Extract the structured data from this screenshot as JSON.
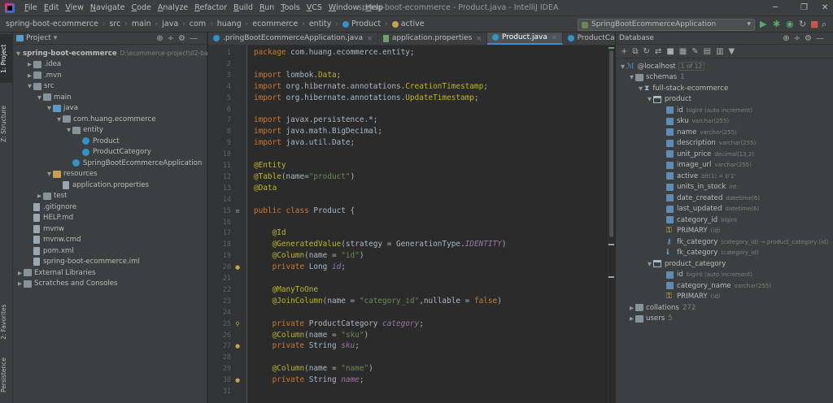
{
  "menu": [
    "File",
    "Edit",
    "View",
    "Navigate",
    "Code",
    "Analyze",
    "Refactor",
    "Build",
    "Run",
    "Tools",
    "VCS",
    "Window",
    "Help"
  ],
  "window_title": "spring-boot-ecommerce - Product.java - IntelliJ IDEA",
  "breadcrumbs": [
    "spring-boot-ecommerce",
    "src",
    "main",
    "java",
    "com",
    "huang",
    "ecommerce",
    "entity",
    "Product",
    "active"
  ],
  "run_config": "SpringBootEcommerceApplication",
  "left_tabs": [
    "1: Project",
    "Z: Structure",
    "2: Favorites",
    "Persistence"
  ],
  "project": {
    "title": "Project",
    "tree": [
      {
        "label": "spring-boot-ecommerce",
        "extra": "D:\\ecommerce-project\\02-backen",
        "depth": 0,
        "arrow": "▼",
        "icon": "folder"
      },
      {
        "label": ".idea",
        "depth": 1,
        "arrow": "▶",
        "icon": "folder"
      },
      {
        "label": ".mvn",
        "depth": 1,
        "arrow": "▶",
        "icon": "folder"
      },
      {
        "label": "src",
        "depth": 1,
        "arrow": "▼",
        "icon": "folder"
      },
      {
        "label": "main",
        "depth": 2,
        "arrow": "▼",
        "icon": "folder"
      },
      {
        "label": "java",
        "depth": 3,
        "arrow": "▼",
        "icon": "folder-blue"
      },
      {
        "label": "com.huang.ecommerce",
        "depth": 4,
        "arrow": "▼",
        "icon": "folder"
      },
      {
        "label": "entity",
        "depth": 5,
        "arrow": "▼",
        "icon": "folder"
      },
      {
        "label": "Product",
        "depth": 6,
        "arrow": "",
        "icon": "cls"
      },
      {
        "label": "ProductCategory",
        "depth": 6,
        "arrow": "",
        "icon": "cls"
      },
      {
        "label": "SpringBootEcommerceApplication",
        "depth": 5,
        "arrow": "",
        "icon": "cls"
      },
      {
        "label": "resources",
        "depth": 3,
        "arrow": "▼",
        "icon": "folder-yellow"
      },
      {
        "label": "application.properties",
        "depth": 4,
        "arrow": "",
        "icon": "file"
      },
      {
        "label": "test",
        "depth": 2,
        "arrow": "▶",
        "icon": "folder"
      },
      {
        "label": ".gitignore",
        "depth": 1,
        "arrow": "",
        "icon": "file"
      },
      {
        "label": "HELP.md",
        "depth": 1,
        "arrow": "",
        "icon": "file"
      },
      {
        "label": "mvnw",
        "depth": 1,
        "arrow": "",
        "icon": "file"
      },
      {
        "label": "mvnw.cmd",
        "depth": 1,
        "arrow": "",
        "icon": "file"
      },
      {
        "label": "pom.xml",
        "depth": 1,
        "arrow": "",
        "icon": "file"
      },
      {
        "label": "spring-boot-ecommerce.iml",
        "depth": 1,
        "arrow": "",
        "icon": "file"
      },
      {
        "label": "External Libraries",
        "depth": 0,
        "arrow": "▶",
        "icon": "folder"
      },
      {
        "label": "Scratches and Consoles",
        "depth": 0,
        "arrow": "▶",
        "icon": "folder"
      }
    ]
  },
  "tabs": [
    {
      "label": ".pringBootEcommerceApplication.java",
      "icon": "cls",
      "active": false
    },
    {
      "label": "application.properties",
      "icon": "file",
      "active": false
    },
    {
      "label": "Product.java",
      "icon": "cls",
      "active": true
    },
    {
      "label": "ProductCategory.java",
      "icon": "cls",
      "active": false
    }
  ],
  "line_numbers": [
    "1",
    "2",
    "3",
    "4",
    "5",
    "6",
    "7",
    "8",
    "9",
    "10",
    "11",
    "12",
    "13",
    "14",
    "15",
    "16",
    "17",
    "18",
    "19",
    "20",
    "21",
    "22",
    "23",
    "24",
    "25",
    "26",
    "27",
    "28",
    "29",
    "30",
    "31"
  ],
  "code": [
    [
      {
        "t": "package ",
        "c": "kw"
      },
      {
        "t": "com.huang.ecommerce.entity;",
        "c": ""
      }
    ],
    [],
    [
      {
        "t": "import ",
        "c": "kw"
      },
      {
        "t": "lombok.",
        "c": ""
      },
      {
        "t": "Data",
        "c": "an"
      },
      {
        "t": ";",
        "c": ""
      }
    ],
    [
      {
        "t": "import ",
        "c": "kw"
      },
      {
        "t": "org.hibernate.annotations.",
        "c": ""
      },
      {
        "t": "CreationTimestamp",
        "c": "an"
      },
      {
        "t": ";",
        "c": ""
      }
    ],
    [
      {
        "t": "import ",
        "c": "kw"
      },
      {
        "t": "org.hibernate.annotations.",
        "c": ""
      },
      {
        "t": "UpdateTimestamp",
        "c": "an"
      },
      {
        "t": ";",
        "c": ""
      }
    ],
    [],
    [
      {
        "t": "import ",
        "c": "kw"
      },
      {
        "t": "javax.persistence.*;",
        "c": ""
      }
    ],
    [
      {
        "t": "import ",
        "c": "kw"
      },
      {
        "t": "java.math.BigDecimal;",
        "c": ""
      }
    ],
    [
      {
        "t": "import ",
        "c": "kw"
      },
      {
        "t": "java.util.Date;",
        "c": ""
      }
    ],
    [],
    [
      {
        "t": "@Entity",
        "c": "an"
      }
    ],
    [
      {
        "t": "@Table",
        "c": "an"
      },
      {
        "t": "(name=",
        "c": ""
      },
      {
        "t": "\"product\"",
        "c": "str"
      },
      {
        "t": ")",
        "c": ""
      }
    ],
    [
      {
        "t": "@Data",
        "c": "an"
      }
    ],
    [],
    [
      {
        "t": "public class ",
        "c": "kw"
      },
      {
        "t": "Product {",
        "c": ""
      }
    ],
    [],
    [
      {
        "t": "    ",
        "c": ""
      },
      {
        "t": "@Id",
        "c": "an"
      }
    ],
    [
      {
        "t": "    ",
        "c": ""
      },
      {
        "t": "@GeneratedValue",
        "c": "an"
      },
      {
        "t": "(strategy = GenerationType.",
        "c": ""
      },
      {
        "t": "IDENTITY",
        "c": "it"
      },
      {
        "t": ")",
        "c": ""
      }
    ],
    [
      {
        "t": "    ",
        "c": ""
      },
      {
        "t": "@Column",
        "c": "an"
      },
      {
        "t": "(name = ",
        "c": ""
      },
      {
        "t": "\"id\"",
        "c": "str"
      },
      {
        "t": ")",
        "c": ""
      }
    ],
    [
      {
        "t": "    ",
        "c": ""
      },
      {
        "t": "private ",
        "c": "kw"
      },
      {
        "t": "Long ",
        "c": ""
      },
      {
        "t": "id",
        "c": "it"
      },
      {
        "t": ";",
        "c": ""
      }
    ],
    [],
    [
      {
        "t": "    ",
        "c": ""
      },
      {
        "t": "@ManyToOne",
        "c": "an"
      }
    ],
    [
      {
        "t": "    ",
        "c": ""
      },
      {
        "t": "@JoinColumn",
        "c": "an"
      },
      {
        "t": "(name = ",
        "c": ""
      },
      {
        "t": "\"category_id\"",
        "c": "str"
      },
      {
        "t": ",",
        "c": ""
      },
      {
        "t": "nullable = ",
        "c": ""
      },
      {
        "t": "false",
        "c": "kw"
      },
      {
        "t": ")",
        "c": ""
      }
    ],
    [],
    [
      {
        "t": "    ",
        "c": ""
      },
      {
        "t": "private ",
        "c": "kw"
      },
      {
        "t": "ProductCategory ",
        "c": ""
      },
      {
        "t": "category",
        "c": "it"
      },
      {
        "t": ";",
        "c": ""
      }
    ],
    [
      {
        "t": "    ",
        "c": ""
      },
      {
        "t": "@Column",
        "c": "an"
      },
      {
        "t": "(name = ",
        "c": ""
      },
      {
        "t": "\"sku\"",
        "c": "str"
      },
      {
        "t": ")",
        "c": ""
      }
    ],
    [
      {
        "t": "    ",
        "c": ""
      },
      {
        "t": "private ",
        "c": "kw"
      },
      {
        "t": "String ",
        "c": ""
      },
      {
        "t": "sku",
        "c": "it"
      },
      {
        "t": ";",
        "c": ""
      }
    ],
    [],
    [
      {
        "t": "    ",
        "c": ""
      },
      {
        "t": "@Column",
        "c": "an"
      },
      {
        "t": "(name = ",
        "c": ""
      },
      {
        "t": "\"name\"",
        "c": "str"
      },
      {
        "t": ")",
        "c": ""
      }
    ],
    [
      {
        "t": "    ",
        "c": ""
      },
      {
        "t": "private ",
        "c": "kw"
      },
      {
        "t": "String ",
        "c": ""
      },
      {
        "t": "name",
        "c": "it"
      },
      {
        "t": ";",
        "c": ""
      }
    ],
    []
  ],
  "gutter_icons": [
    {
      "line": "15",
      "glyph": "≡",
      "color": "#9aa7b0"
    },
    {
      "line": "20",
      "glyph": "●",
      "color": "#c9a24f"
    },
    {
      "line": "25",
      "glyph": "⚲",
      "color": "#c9a24f"
    },
    {
      "line": "27",
      "glyph": "●",
      "color": "#c9a24f"
    },
    {
      "line": "30",
      "glyph": "●",
      "color": "#c9a24f"
    }
  ],
  "database": {
    "title": "Database",
    "host": "@localhost",
    "host_badge": "1 of 12",
    "schemas_label": "schemas",
    "schemas_badge": "1",
    "schema": "full-stack-ecommerce",
    "tables": [
      {
        "name": "product",
        "columns": [
          {
            "name": "id",
            "type": "bigint (auto increment)",
            "kind": "col"
          },
          {
            "name": "sku",
            "type": "varchar(255)",
            "kind": "col"
          },
          {
            "name": "name",
            "type": "varchar(255)",
            "kind": "col"
          },
          {
            "name": "description",
            "type": "varchar(255)",
            "kind": "col"
          },
          {
            "name": "unit_price",
            "type": "decimal(13,2)",
            "kind": "col"
          },
          {
            "name": "image_url",
            "type": "varchar(255)",
            "kind": "col"
          },
          {
            "name": "active",
            "type": "bit(1) = b'1'",
            "kind": "col"
          },
          {
            "name": "units_in_stock",
            "type": "int",
            "kind": "col"
          },
          {
            "name": "date_created",
            "type": "datetime(6)",
            "kind": "col"
          },
          {
            "name": "last_updated",
            "type": "datetime(6)",
            "kind": "col"
          },
          {
            "name": "category_id",
            "type": "bigint",
            "kind": "col"
          },
          {
            "name": "PRIMARY",
            "type": "(id)",
            "kind": "key"
          },
          {
            "name": "fk_category",
            "type": "(category_id) → product_category (id)",
            "kind": "fk"
          },
          {
            "name": "fk_category",
            "type": "(category_id)",
            "kind": "idx"
          }
        ]
      },
      {
        "name": "product_category",
        "columns": [
          {
            "name": "id",
            "type": "bigint (auto increment)",
            "kind": "col"
          },
          {
            "name": "category_name",
            "type": "varchar(255)",
            "kind": "col"
          },
          {
            "name": "PRIMARY",
            "type": "(id)",
            "kind": "key"
          }
        ]
      }
    ],
    "others": [
      {
        "name": "collations",
        "badge": "272"
      },
      {
        "name": "users",
        "badge": "5"
      }
    ]
  }
}
